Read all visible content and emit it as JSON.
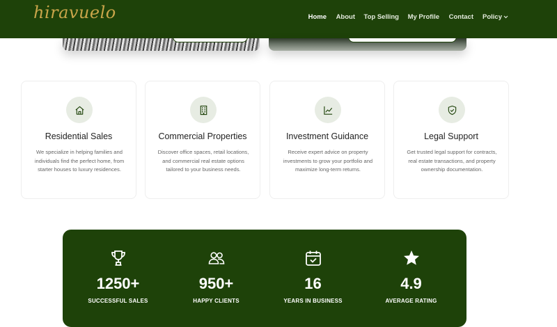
{
  "brand": {
    "logo_text": "hiravuelo"
  },
  "nav": {
    "items": [
      {
        "label": "Home",
        "active": true
      },
      {
        "label": "About"
      },
      {
        "label": "Top Selling"
      },
      {
        "label": "My Profile"
      },
      {
        "label": "Contact"
      },
      {
        "label": "Policy",
        "has_dropdown": true
      }
    ]
  },
  "services": [
    {
      "icon": "house-icon",
      "title": "Residential Sales",
      "text": "We specialize in helping families and individuals find the perfect home, from starter houses to luxury residences."
    },
    {
      "icon": "building-icon",
      "title": "Commercial Properties",
      "text": "Discover office spaces, retail locations, and commercial real estate options tailored to your business needs."
    },
    {
      "icon": "chart-line-icon",
      "title": "Investment Guidance",
      "text": "Receive expert advice on property investments to grow your portfolio and maximize long-term returns."
    },
    {
      "icon": "shield-check-icon",
      "title": "Legal Support",
      "text": "Get trusted legal support for contracts, real estate transactions, and property ownership documentation."
    }
  ],
  "stats": [
    {
      "icon": "trophy-icon",
      "value": "1250+",
      "label": "SUCCESSFUL SALES"
    },
    {
      "icon": "users-icon",
      "value": "950+",
      "label": "HAPPY CLIENTS"
    },
    {
      "icon": "calendar-check-icon",
      "value": "16",
      "label": "YEARS IN BUSINESS"
    },
    {
      "icon": "star-icon",
      "value": "4.9",
      "label": "AVERAGE RATING"
    }
  ],
  "colors": {
    "primary": "#1e4209",
    "gold": "#c9a54a",
    "icon_bg": "#e7ece3"
  }
}
